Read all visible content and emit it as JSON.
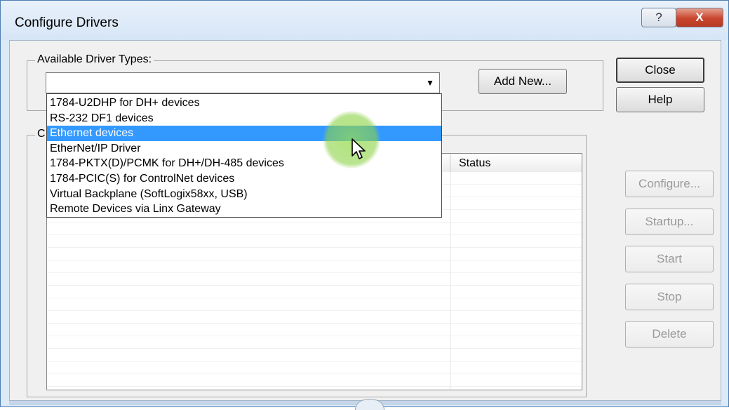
{
  "window": {
    "title": "Configure Drivers",
    "help_glyph": "?",
    "close_glyph": "X"
  },
  "available": {
    "group_label": "Available Driver Types:",
    "combo_value": "",
    "dropdown_arrow": "▼",
    "add_new_label": "Add New..."
  },
  "dropdown": {
    "items": [
      "1784-U2DHP for DH+ devices",
      "RS-232 DF1 devices",
      "Ethernet devices",
      "EtherNet/IP Driver",
      "1784-PKTX(D)/PCMK for DH+/DH-485 devices",
      "1784-PCIC(S) for ControlNet devices",
      "Virtual Backplane (SoftLogix58xx, USB)",
      "Remote Devices via Linx Gateway"
    ],
    "selected_index": 2
  },
  "configured": {
    "group_label": "C",
    "columns": [
      "Status"
    ]
  },
  "side_buttons": {
    "close": "Close",
    "help": "Help",
    "configure": "Configure...",
    "startup": "Startup...",
    "start": "Start",
    "stop": "Stop",
    "delete": "Delete"
  },
  "colors": {
    "selection": "#3399ff",
    "highlight_circle": "#8fd14f"
  }
}
